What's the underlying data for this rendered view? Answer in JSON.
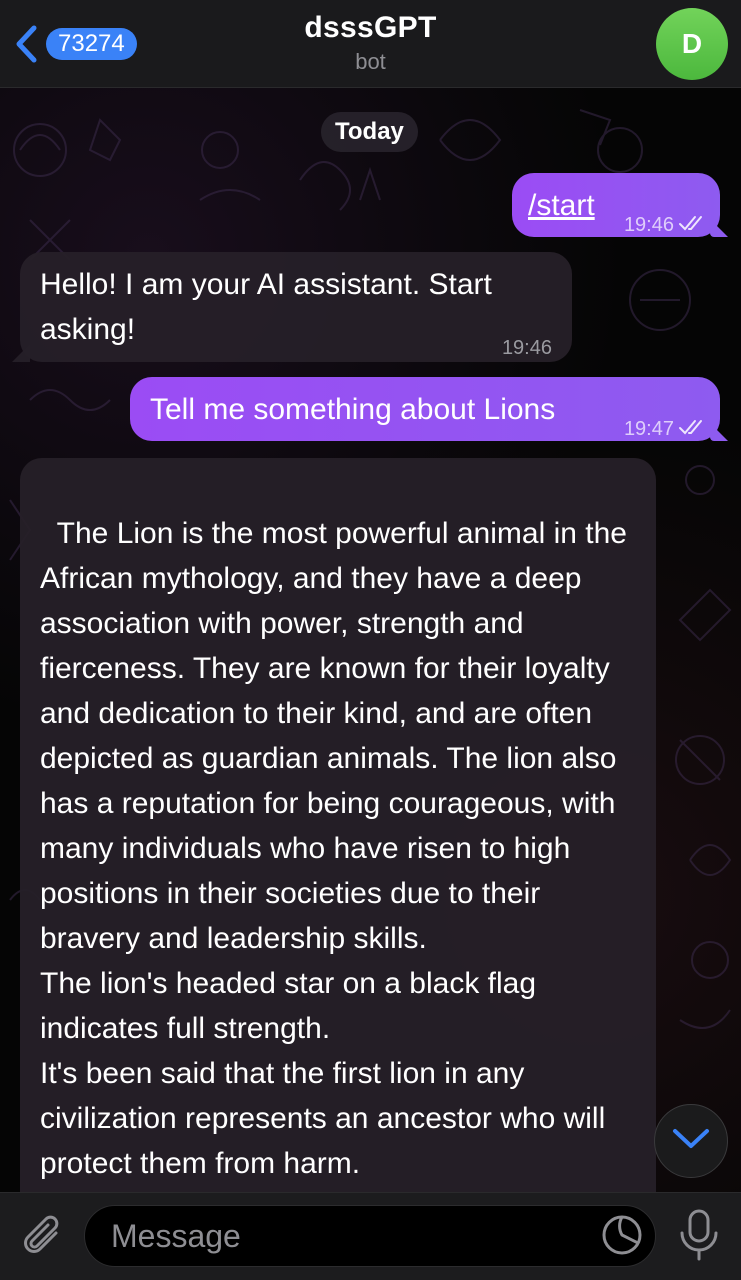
{
  "header": {
    "unread_count": "73274",
    "title": "dsssGPT",
    "subtitle": "bot",
    "avatar_letter": "D"
  },
  "date_separator": "Today",
  "messages": [
    {
      "direction": "outgoing",
      "text": "/start",
      "time": "19:46",
      "status": "read"
    },
    {
      "direction": "incoming",
      "text": "Hello! I am your AI assistant. Start asking!",
      "time": "19:46"
    },
    {
      "direction": "outgoing",
      "text": "Tell me something about Lions",
      "time": "19:47",
      "status": "read"
    },
    {
      "direction": "incoming",
      "text": "The Lion is the most powerful animal in the African mythology, and they have a deep association with power, strength and fierceness. They are known for their loyalty and dedication to their kind, and are often depicted as guardian animals. The lion also has a reputation for being courageous, with many individuals who have risen to high positions in their societies due to their bravery and leadership skills.\nThe lion's headed star on a black flag indicates full strength.\nIt's been said that the first lion in any civilization represents an ancestor who will protect them from harm."
    }
  ],
  "composer": {
    "placeholder": "Message"
  },
  "icons": {
    "back": "chevron-left-icon",
    "read_status": "double-check-icon",
    "scroll_down": "chevron-down-icon",
    "attach": "paperclip-icon",
    "sticker": "sticker-icon",
    "mic": "microphone-icon"
  },
  "colors": {
    "accent": "#3a82f7",
    "outgoing_bubble": "#9552f3",
    "incoming_bubble": "#262028",
    "avatar": "#5cc448"
  }
}
